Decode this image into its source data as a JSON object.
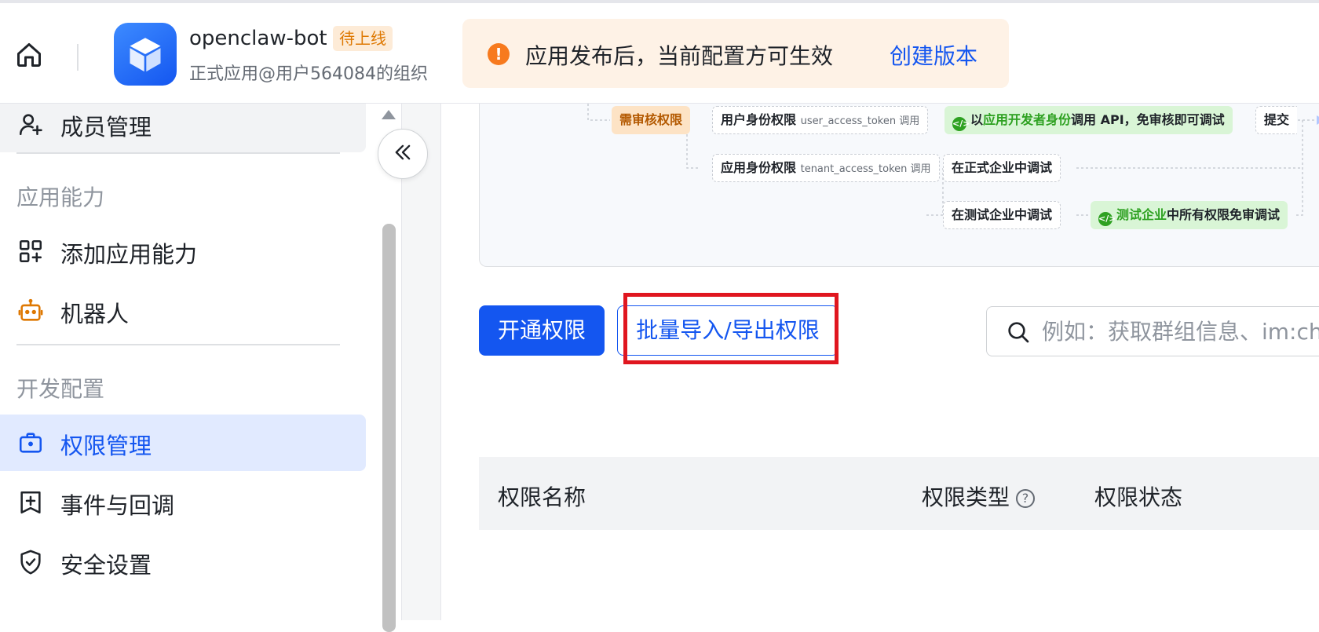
{
  "header": {
    "app_name": "openclaw-bot",
    "app_badge": "待上线",
    "app_org": "正式应用@用户564084的组织",
    "notice_icon": "!",
    "notice_text": "应用发布后，当前配置方可生效",
    "notice_link": "创建版本"
  },
  "sidebar": {
    "items": [
      {
        "label": "成员管理",
        "icon": "user-add-icon"
      },
      {
        "label": "添加应用能力",
        "icon": "grid-add-icon"
      },
      {
        "label": "机器人",
        "icon": "robot-icon"
      },
      {
        "label": "权限管理",
        "icon": "permission-icon"
      },
      {
        "label": "事件与回调",
        "icon": "event-icon"
      },
      {
        "label": "安全设置",
        "icon": "shield-icon"
      }
    ],
    "sections": {
      "capability": "应用能力",
      "dev_config": "开发配置"
    },
    "collapse_glyph": "«"
  },
  "flow": {
    "review_label": "需审核权限",
    "user_identity": "用户身份权限",
    "user_token": "user_access_token 调用",
    "app_identity": "应用身份权限",
    "tenant_token": "tenant_access_token 调用",
    "dev_call_prefix": "以",
    "dev_call_highlight": "应用开发者身份",
    "dev_call_suffix": "调用 API，免审核即可调试",
    "submit_partial": "提交",
    "formal_debug": "在正式企业中调试",
    "test_debug": "在测试企业中调试",
    "test_free_highlight": "测试企业",
    "test_free_suffix": "中所有权限免审调试"
  },
  "toolbar": {
    "enable_label": "开通权限",
    "bulk_label": "批量导入/导出权限",
    "search_placeholder": "例如：获取群组信息、im:chat"
  },
  "table": {
    "columns": [
      "权限名称",
      "权限类型",
      "权限状态"
    ],
    "help_glyph": "?"
  },
  "colors": {
    "accent": "#1456f0",
    "active_bg": "#e1eaff",
    "notice_bg": "#fef2e6",
    "notice_icon": "#f77a1e",
    "highlight_box": "#e0161f"
  }
}
